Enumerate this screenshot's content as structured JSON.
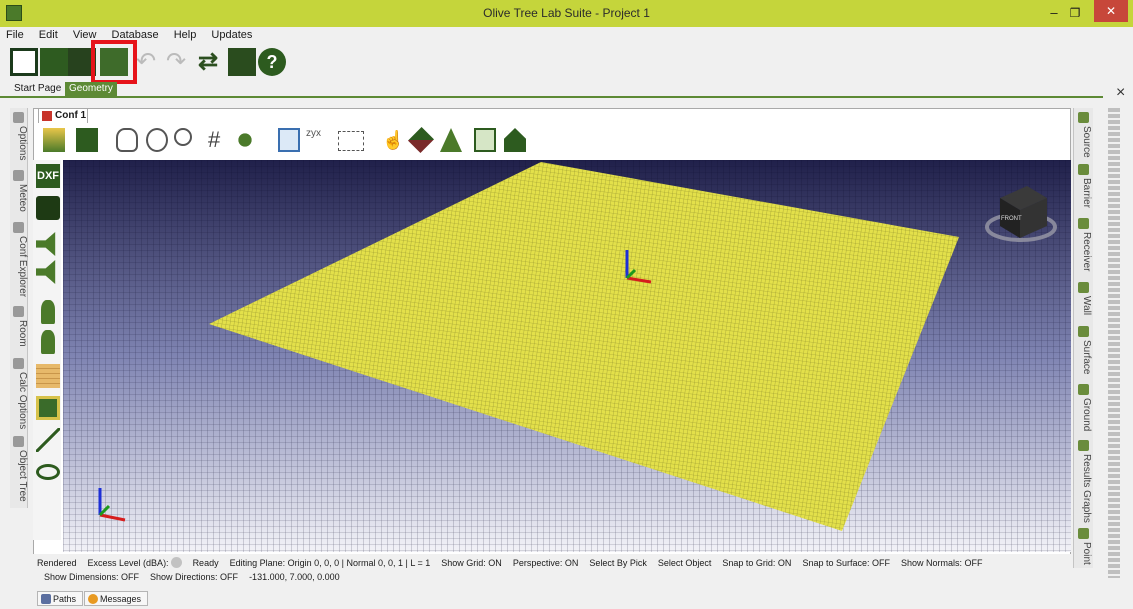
{
  "window": {
    "title": "Olive Tree Lab Suite - Project 1",
    "minimize_glyph": "–",
    "maximize_glyph": "❐",
    "close_glyph": "✕"
  },
  "menu": [
    "File",
    "Edit",
    "View",
    "Database",
    "Help",
    "Updates"
  ],
  "toolbar": {
    "icons": [
      "new-file-icon",
      "open-folder-icon",
      "save-icon",
      "save-as-icon",
      "undo-icon",
      "redo-icon",
      "refresh-icon",
      "print-icon",
      "help-icon"
    ],
    "help_glyph": "?",
    "undo_glyph": "↶",
    "redo_glyph": "↷",
    "refresh_glyph": "⇄",
    "highlight_color": "#e6131a"
  },
  "tabs": {
    "start": "Start Page",
    "geometry": "Geometry",
    "close_glyph": "×"
  },
  "left_dock": [
    "Options",
    "Meteo",
    "Conf Explorer",
    "Room",
    "Calc Options",
    "Object Tree"
  ],
  "right_dock": [
    "Source",
    "Barrier",
    "Receiver",
    "Wall",
    "Surface",
    "Ground",
    "Results Graphs",
    "Point"
  ],
  "document": {
    "tab": "Conf 1"
  },
  "left_tools": {
    "dxf": "DXF"
  },
  "viewport": {
    "plane_color": "#e3e04a",
    "sky_top": "#20204a",
    "sky_bottom": "#f2f2f7",
    "cube_label": "FRONT"
  },
  "status": {
    "line1": [
      "Rendered",
      "Excess Level (dBA):",
      "Ready",
      "Editing Plane: Origin 0, 0, 0 | Normal 0, 0, 1 | L = 1",
      "Show Grid: ON",
      "Perspective: ON",
      "Select By Pick",
      "Select Object",
      "Snap to Grid: ON",
      "Snap to Surface: OFF",
      "Show Normals: OFF"
    ],
    "line2": [
      "Show Dimensions: OFF",
      "Show Directions: OFF",
      "-131.000, 7.000, 0.000"
    ]
  },
  "bottom_tabs": [
    "Paths",
    "Messages"
  ]
}
